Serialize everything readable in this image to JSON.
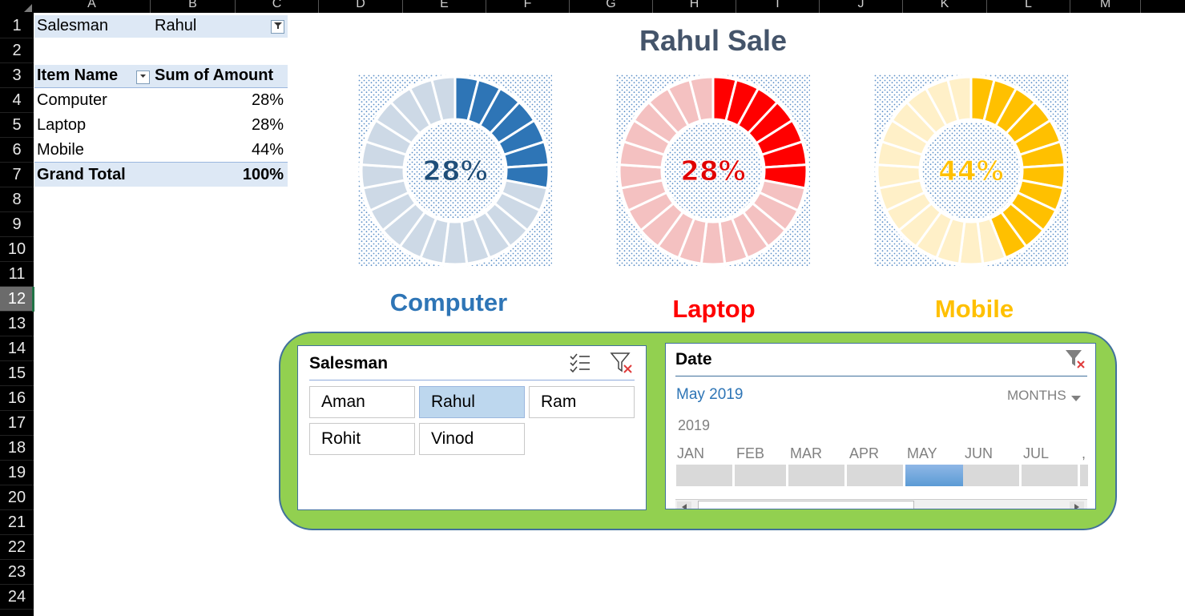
{
  "columns": [
    "A",
    "B",
    "C",
    "D",
    "E",
    "F",
    "G",
    "H",
    "I",
    "J",
    "K",
    "L",
    "M"
  ],
  "rows": [
    "1",
    "2",
    "3",
    "4",
    "5",
    "6",
    "7",
    "8",
    "9",
    "10",
    "11",
    "12",
    "13",
    "14",
    "15",
    "16",
    "17",
    "18",
    "19",
    "20",
    "21",
    "22",
    "23",
    "24"
  ],
  "selected_row": "12",
  "pivot": {
    "filter_label": "Salesman",
    "filter_value": "Rahul",
    "header_item": "Item Name",
    "header_sum": "Sum of Amount",
    "rows": [
      {
        "item": "Computer",
        "value": "28%"
      },
      {
        "item": "Laptop",
        "value": "28%"
      },
      {
        "item": "Mobile",
        "value": "44%"
      }
    ],
    "total_label": "Grand Total",
    "total_value": "100%"
  },
  "dashboard": {
    "title": "Rahul Sale",
    "charts": [
      {
        "label": "Computer",
        "pct_text": "28%",
        "value": 0.28,
        "color": "#2e75b6",
        "light": "#cdd9e6",
        "text_color": "#1f4e79"
      },
      {
        "label": "Laptop",
        "pct_text": "28%",
        "value": 0.28,
        "color": "#ff0000",
        "light": "#f4c1c1",
        "text_color": "#e00000"
      },
      {
        "label": "Mobile",
        "pct_text": "44%",
        "value": 0.44,
        "color": "#ffc000",
        "light": "#fff0c8",
        "text_color": "#ffc000"
      }
    ]
  },
  "salesman_slicer": {
    "header": "Salesman",
    "items": [
      "Aman",
      "Rahul",
      "Ram",
      "Rohit",
      "Vinod"
    ],
    "selected": "Rahul"
  },
  "date_slicer": {
    "header": "Date",
    "selection": "May 2019",
    "level": "MONTHS",
    "year": "2019",
    "months": [
      "JAN",
      "FEB",
      "MAR",
      "APR",
      "MAY",
      "JUN",
      "JUL"
    ],
    "selected_month": "MAY"
  },
  "icons": {
    "multiselect": "multi-select-icon",
    "clear_filter": "clear-filter-icon",
    "dropdown": "chevron-down-icon"
  }
}
